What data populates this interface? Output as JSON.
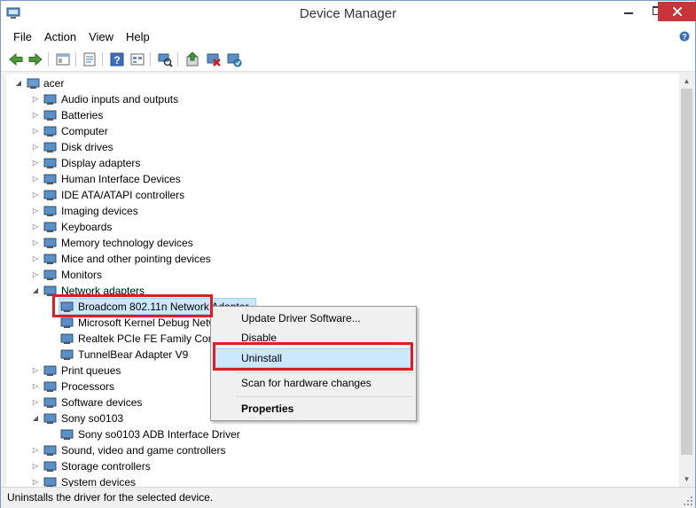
{
  "window": {
    "title": "Device Manager"
  },
  "menu": {
    "items": [
      "File",
      "Action",
      "View",
      "Help"
    ]
  },
  "toolbar": {
    "icons": [
      "back-icon",
      "forward-icon",
      "show-hide-tree-icon",
      "properties-icon",
      "help-icon",
      "view-icon",
      "scan-hardware-icon",
      "update-driver-icon",
      "uninstall-icon",
      "enable-disable-icon"
    ]
  },
  "tree": {
    "root": "acer",
    "categories": [
      {
        "label": "Audio inputs and outputs",
        "icon": "speaker-icon"
      },
      {
        "label": "Batteries",
        "icon": "battery-icon"
      },
      {
        "label": "Computer",
        "icon": "computer-icon"
      },
      {
        "label": "Disk drives",
        "icon": "disk-drive-icon"
      },
      {
        "label": "Display adapters",
        "icon": "display-adapter-icon"
      },
      {
        "label": "Human Interface Devices",
        "icon": "hid-icon"
      },
      {
        "label": "IDE ATA/ATAPI controllers",
        "icon": "ide-controller-icon"
      },
      {
        "label": "Imaging devices",
        "icon": "camera-icon"
      },
      {
        "label": "Keyboards",
        "icon": "keyboard-icon"
      },
      {
        "label": "Memory technology devices",
        "icon": "memory-icon"
      },
      {
        "label": "Mice and other pointing devices",
        "icon": "mouse-icon"
      },
      {
        "label": "Monitors",
        "icon": "monitor-icon"
      },
      {
        "label": "Network adapters",
        "icon": "network-icon",
        "expanded": true
      },
      {
        "label": "Print queues",
        "icon": "printer-icon"
      },
      {
        "label": "Processors",
        "icon": "processor-icon"
      },
      {
        "label": "Software devices",
        "icon": "software-device-icon"
      },
      {
        "label": "Sony so0103",
        "icon": "phone-icon",
        "expanded": true
      },
      {
        "label": "Sound, video and game controllers",
        "icon": "speaker-icon"
      },
      {
        "label": "Storage controllers",
        "icon": "storage-icon"
      },
      {
        "label": "System devices",
        "icon": "system-device-icon"
      }
    ],
    "network_children": [
      {
        "label": "Broadcom 802.11n Network Adapter",
        "selected": true
      },
      {
        "label": "Microsoft Kernel Debug Network Adapter"
      },
      {
        "label": "Realtek PCIe FE Family Controller"
      },
      {
        "label": "TunnelBear Adapter V9"
      }
    ],
    "sony_children": [
      {
        "label": "Sony so0103 ADB Interface Driver"
      }
    ]
  },
  "context_menu": {
    "items": [
      "Update Driver Software...",
      "Disable",
      "Uninstall",
      "Scan for hardware changes",
      "Properties"
    ],
    "highlighted": "Uninstall"
  },
  "status": {
    "text": "Uninstalls the driver for the selected device."
  }
}
